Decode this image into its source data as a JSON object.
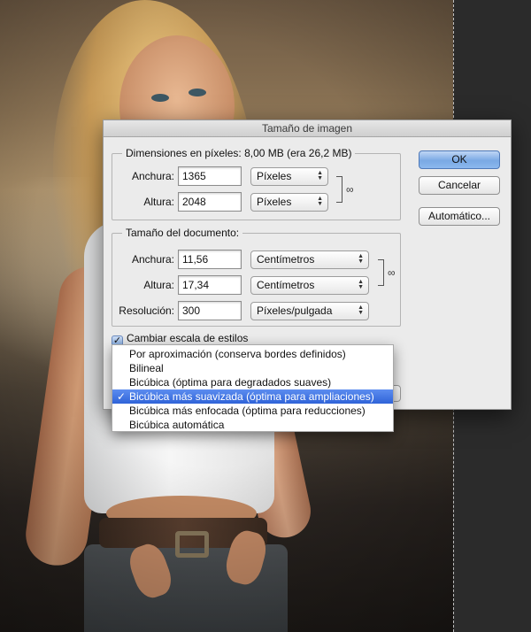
{
  "dialog": {
    "title": "Tamaño de imagen",
    "pixel_dimensions": {
      "legend": "Dimensiones en píxeles: 8,00 MB (era 26,2 MB)",
      "width_label": "Anchura:",
      "width_value": "1365",
      "width_unit": "Píxeles",
      "height_label": "Altura:",
      "height_value": "2048",
      "height_unit": "Píxeles"
    },
    "document_size": {
      "legend": "Tamaño del documento:",
      "width_label": "Anchura:",
      "width_value": "11,56",
      "width_unit": "Centímetros",
      "height_label": "Altura:",
      "height_value": "17,34",
      "height_unit": "Centímetros",
      "resolution_label": "Resolución:",
      "resolution_value": "300",
      "resolution_unit": "Píxeles/pulgada"
    },
    "buttons": {
      "ok": "OK",
      "cancel": "Cancelar",
      "auto": "Automático..."
    },
    "scale_styles_label": "Cambiar escala de estilos"
  },
  "resample_menu": {
    "items": [
      "Por aproximación (conserva bordes definidos)",
      "Bilineal",
      "Bicúbica (óptima para degradados suaves)",
      "Bicúbica más suavizada (óptima para ampliaciones)",
      "Bicúbica más enfocada (óptima para reducciones)",
      "Bicúbica automática"
    ],
    "selected_index": 3,
    "check_glyph": "✓"
  },
  "colors": {
    "selection": "#3a6fe0",
    "primary_button": "#8cb8ee",
    "dialog_bg": "#ebebeb"
  }
}
